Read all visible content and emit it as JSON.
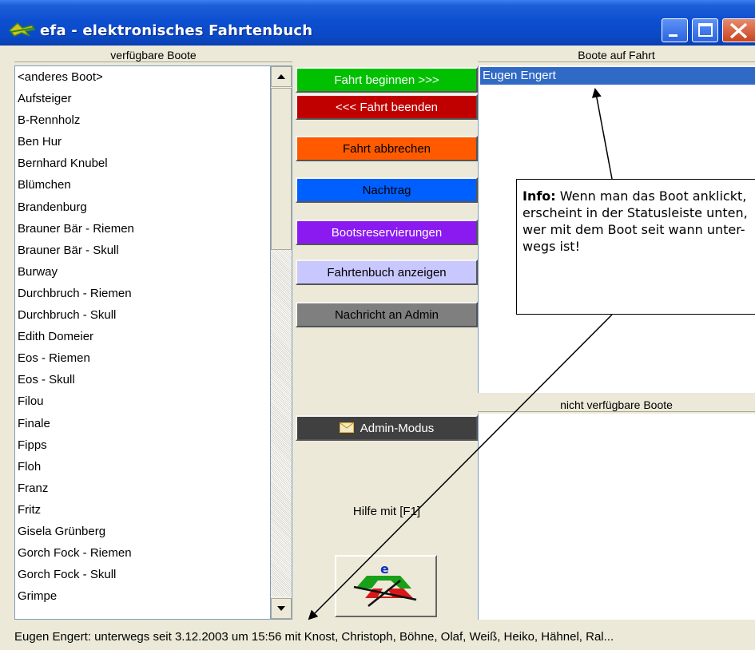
{
  "window": {
    "title": "efa - elektronisches Fahrtenbuch",
    "title_icon": "efa-app-icon"
  },
  "left_panel": {
    "header": "verfügbare Boote",
    "boats": [
      "<anderes Boot>",
      "Aufsteiger",
      "B-Rennholz",
      "Ben Hur",
      "Bernhard Knubel",
      "Blümchen",
      "Brandenburg",
      "Brauner Bär - Riemen",
      "Brauner Bär - Skull",
      "Burway",
      "Durchbruch - Riemen",
      "Durchbruch - Skull",
      "Edith Domeier",
      "Eos - Riemen",
      "Eos - Skull",
      "Filou",
      "Finale",
      "Fipps",
      "Floh",
      "Franz",
      "Fritz",
      "Gisela Grünberg",
      "Gorch Fock - Riemen",
      "Gorch Fock - Skull",
      "Grimpe"
    ]
  },
  "actions": {
    "start": "Fahrt beginnen >>>",
    "end": "<<< Fahrt beenden",
    "abort": "Fahrt abbrechen",
    "supplement": "Nachtrag",
    "reservations": "Bootsreservierungen",
    "show_logbook": "Fahrtenbuch anzeigen",
    "message_admin": "Nachricht an Admin",
    "admin_mode": "Admin-Modus",
    "admin_mode_icon": "envelope-icon",
    "help": "Hilfe mit [F1]",
    "logo_letter": "e",
    "colors": {
      "start": "#00c000",
      "end": "#c00000",
      "abort": "#ff5a00",
      "supplement": "#0060ff",
      "reservations": "#8a1af0",
      "show_logbook": "#c8c8ff",
      "message_admin": "#7f7f7f",
      "admin_mode": "#404040"
    }
  },
  "right_panel": {
    "header_on_trip": "Boote auf Fahrt",
    "on_trip": [
      "Eugen Engert"
    ],
    "header_unavailable": "nicht verfügbare Boote",
    "unavailable": []
  },
  "info_box": {
    "label": "Info:",
    "text": " Wenn man das Boot anklickt, erscheint in der Statusleiste unten, wer mit dem Boot seit wann unter-wegs ist!"
  },
  "statusbar": {
    "text": "Eugen Engert: unterwegs seit 3.12.2003 um 15:56 mit Knost, Christoph, Böhne, Olaf, Weiß, Heiko, Hähnel, Ral..."
  }
}
